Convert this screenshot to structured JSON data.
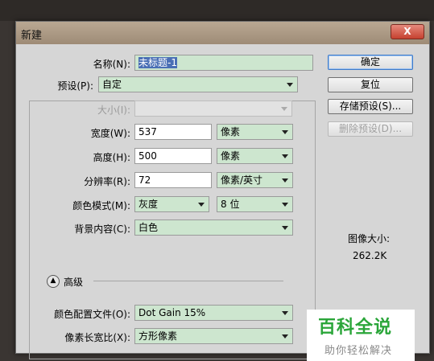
{
  "window": {
    "title": "新建",
    "close_label": "X"
  },
  "form": {
    "name": {
      "label": "名称(N):",
      "value": "未标题-1"
    },
    "preset": {
      "label": "预设(P):",
      "value": "自定"
    },
    "size": {
      "label": "大小(I):",
      "value": ""
    },
    "width": {
      "label": "宽度(W):",
      "value": "537",
      "unit": "像素"
    },
    "height": {
      "label": "高度(H):",
      "value": "500",
      "unit": "像素"
    },
    "resolution": {
      "label": "分辨率(R):",
      "value": "72",
      "unit": "像素/英寸"
    },
    "color_mode": {
      "label": "颜色模式(M):",
      "value": "灰度",
      "bits": "8 位"
    },
    "background": {
      "label": "背景内容(C):",
      "value": "白色"
    },
    "advanced": {
      "label": "高级"
    },
    "color_profile": {
      "label": "颜色配置文件(O):",
      "value": "Dot Gain 15%"
    },
    "pixel_aspect": {
      "label": "像素长宽比(X):",
      "value": "方形像素"
    }
  },
  "buttons": {
    "ok": "确定",
    "reset": "复位",
    "save_preset": "存储预设(S)...",
    "delete_preset": "删除预设(D)..."
  },
  "image_size": {
    "label": "图像大小:",
    "value": "262.2K"
  },
  "watermark": {
    "main": "百科全说",
    "sub": "助你轻松解决"
  }
}
